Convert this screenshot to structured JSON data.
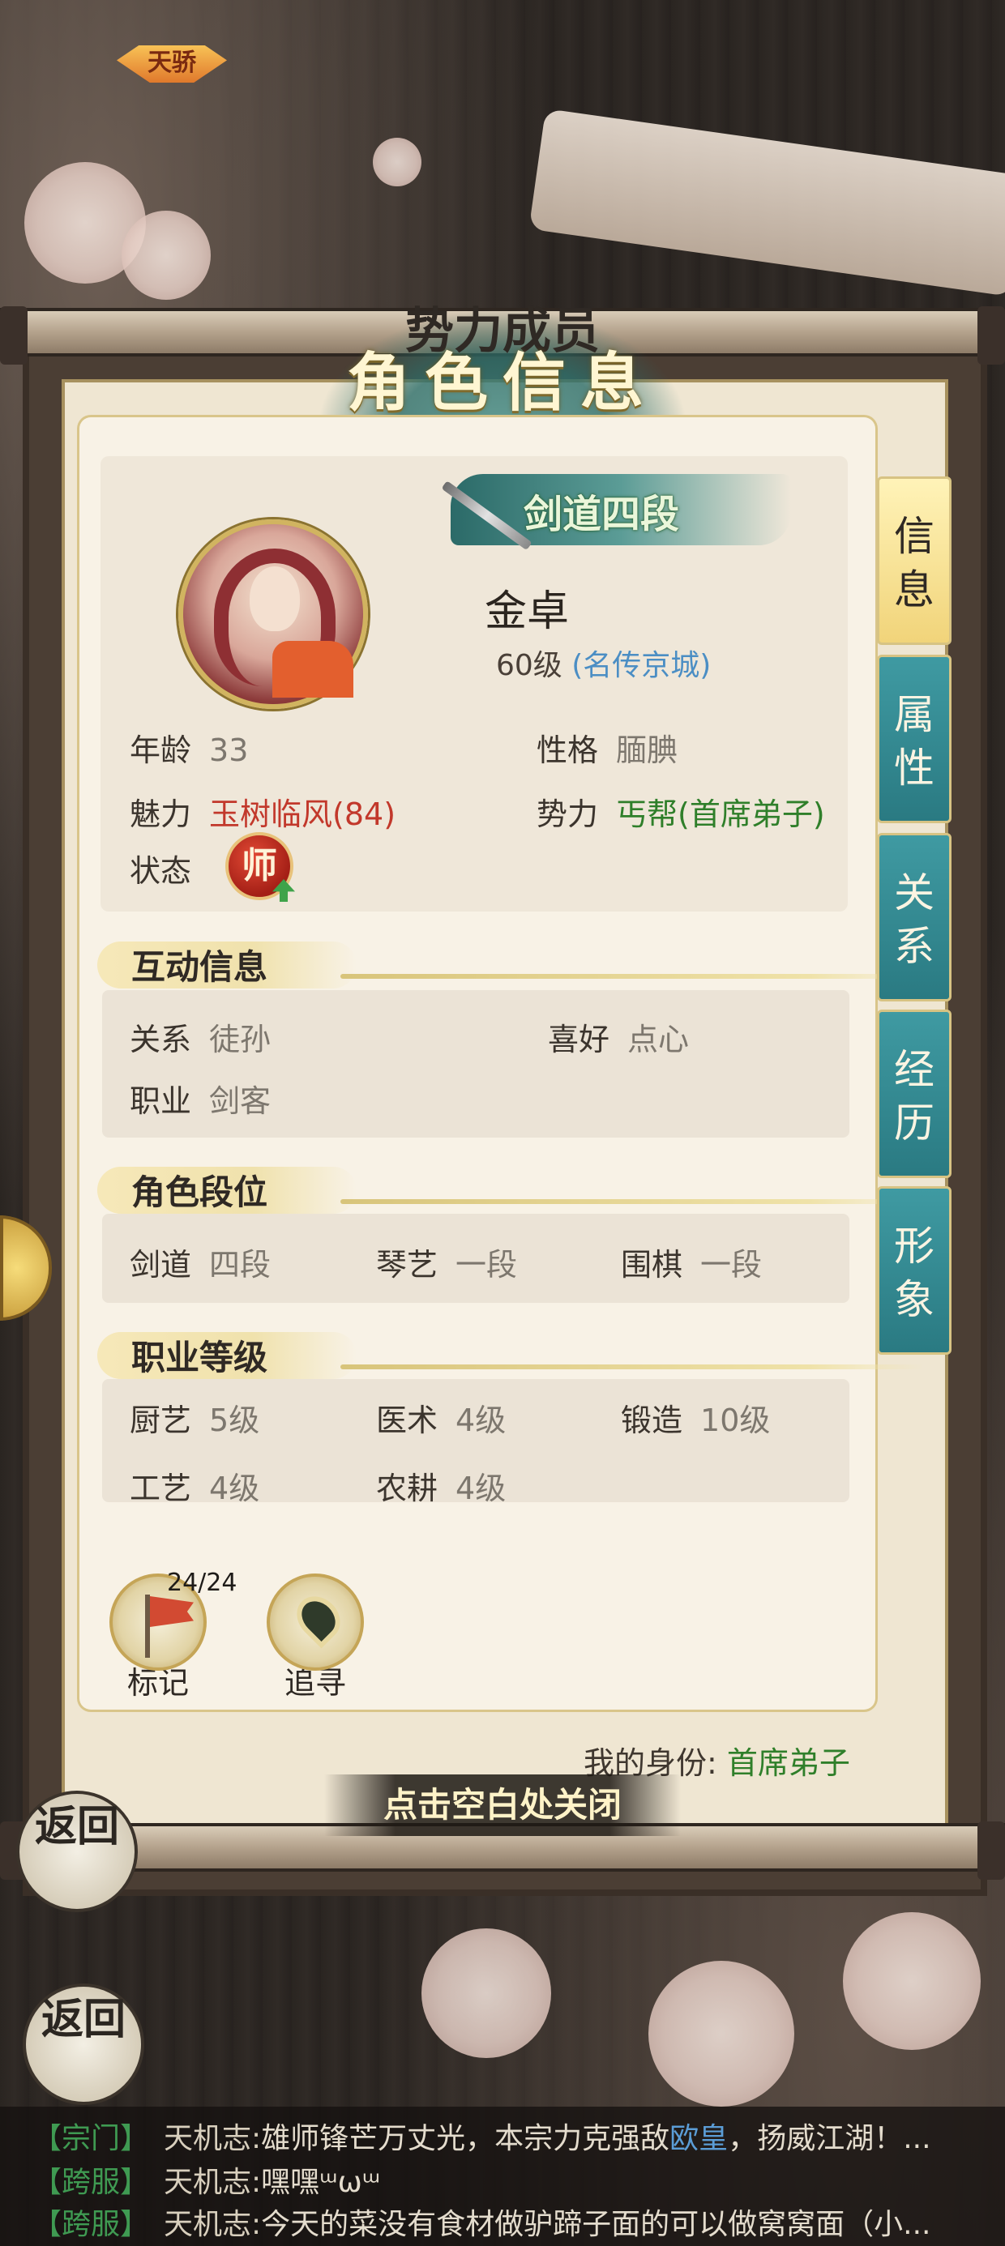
{
  "header": {
    "subtitle": "势力成员",
    "title": "角色信息"
  },
  "profile": {
    "avatar_tag": "天骄",
    "rank_badge": "剑道四段",
    "name": "金卓",
    "level": "60级",
    "fame": "(名传京城)",
    "fields": {
      "age_label": "年龄",
      "age_value": "33",
      "personality_label": "性格",
      "personality_value": "腼腆",
      "charm_label": "魅力",
      "charm_value": "玉树临风(84)",
      "faction_label": "势力",
      "faction_value": "丐帮(首席弟子)",
      "status_label": "状态",
      "status_badge": "师"
    }
  },
  "interaction": {
    "heading": "互动信息",
    "relation_label": "关系",
    "relation_value": "徒孙",
    "hobby_label": "喜好",
    "hobby_value": "点心",
    "job_label": "职业",
    "job_value": "剑客"
  },
  "ranks": {
    "heading": "角色段位",
    "items": [
      {
        "label": "剑道",
        "value": "四段"
      },
      {
        "label": "琴艺",
        "value": "一段"
      },
      {
        "label": "围棋",
        "value": "一段"
      }
    ]
  },
  "professions": {
    "heading": "职业等级",
    "items": [
      {
        "label": "厨艺",
        "value": "5级"
      },
      {
        "label": "医术",
        "value": "4级"
      },
      {
        "label": "锻造",
        "value": "10级"
      },
      {
        "label": "工艺",
        "value": "4级"
      },
      {
        "label": "农耕",
        "value": "4级"
      }
    ]
  },
  "tabs": [
    {
      "label": "信息",
      "active": true
    },
    {
      "label": "属性",
      "active": false
    },
    {
      "label": "关系",
      "active": false
    },
    {
      "label": "经历",
      "active": false
    },
    {
      "label": "形象",
      "active": false
    }
  ],
  "actions": {
    "mark_label": "标记",
    "mark_count": "24/24",
    "trace_label": "追寻"
  },
  "identity": {
    "label": "我的身份:",
    "value": "首席弟子"
  },
  "close_hint": "点击空白处关闭",
  "back_label": "返回",
  "chat": [
    {
      "channel": "【宗门】",
      "speaker": "天机志:",
      "text_before": "雄师锋芒万丈光，本宗力克强敌",
      "highlight": "欧皇",
      "text_after": "，扬威江湖！..."
    },
    {
      "channel": "【跨服】",
      "speaker": "天机志:",
      "text_before": "嘿嘿ᵚωᵚ",
      "highlight": "",
      "text_after": ""
    },
    {
      "channel": "【跨服】",
      "speaker": "天机志:",
      "text_before": "今天的菜没有食材做驴蹄子面的可以做窝窝面（小...",
      "highlight": "",
      "text_after": ""
    }
  ],
  "colors": {
    "tab_teal": "#2a7a82",
    "tab_active": "#f1d47a",
    "charm_red": "#c2382b",
    "faction_green": "#2f7f2a",
    "fame_blue": "#4b8ec4"
  }
}
